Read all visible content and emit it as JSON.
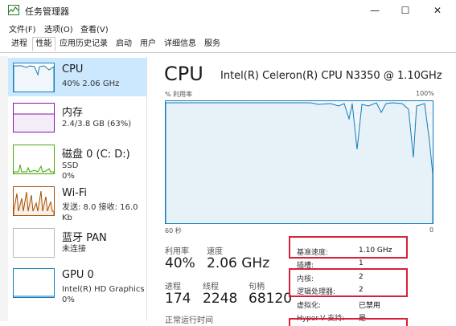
{
  "window": {
    "title": "任务管理器",
    "minimize": "—",
    "maximize": "☐",
    "close": "✕"
  },
  "menu": [
    "文件(F)",
    "选项(O)",
    "查看(V)"
  ],
  "tabs": [
    "进程",
    "性能",
    "应用历史记录",
    "启动",
    "用户",
    "详细信息",
    "服务"
  ],
  "active_tab": "性能",
  "sidebar": {
    "cpu": {
      "name": "CPU",
      "sub": "40% 2.06 GHz"
    },
    "memory": {
      "name": "内存",
      "sub": "2.4/3.8 GB (63%)"
    },
    "disk": {
      "name": "磁盘 0 (C: D:)",
      "sub": "SSD",
      "sub2": "0%"
    },
    "wifi": {
      "name": "Wi-Fi",
      "sub": "发送: 8.0 接收: 16.0 Kb"
    },
    "bluetooth": {
      "name": "蓝牙 PAN",
      "sub": "未连接"
    },
    "gpu": {
      "name": "GPU 0",
      "sub": "Intel(R) HD Graphics",
      "sub2": "0%"
    }
  },
  "main": {
    "title": "CPU",
    "model": "Intel(R) Celeron(R) CPU N3350 @ 1.10GHz",
    "graph_label": "% 利用率",
    "graph_max": "100%",
    "graph_time": "60 秒",
    "graph_min": "0",
    "utilization_label": "利用率",
    "utilization": "40%",
    "speed_label": "速度",
    "speed": "2.06 GHz",
    "processes_label": "进程",
    "processes": "174",
    "threads_label": "线程",
    "threads": "2248",
    "handles_label": "句柄",
    "handles": "68120",
    "uptime_label": "正常运行时间"
  },
  "specs": [
    {
      "label": "基准速度:",
      "value": "1.10 GHz"
    },
    {
      "label": "插槽:",
      "value": "1"
    },
    {
      "label": "内核:",
      "value": "2"
    },
    {
      "label": "逻辑处理器:",
      "value": "2"
    },
    {
      "label": "虚拟化:",
      "value": "已禁用"
    },
    {
      "label": "Hyper-V 支持:",
      "value": "是"
    }
  ],
  "colors": {
    "cpu_line": "#117dbb",
    "memory_line": "#8b12ae",
    "disk_line": "#4da60c",
    "wifi_line": "#a74f01",
    "highlight": "#d6213a",
    "selected_bg": "#cce8ff"
  }
}
